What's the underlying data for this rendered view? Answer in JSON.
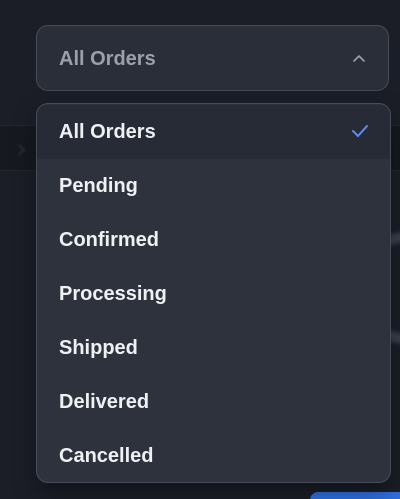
{
  "select": {
    "value": "All Orders",
    "expanded": true
  },
  "dropdown": {
    "selected_index": 0,
    "items": [
      {
        "label": "All Orders"
      },
      {
        "label": "Pending"
      },
      {
        "label": "Confirmed"
      },
      {
        "label": "Processing"
      },
      {
        "label": "Shipped"
      },
      {
        "label": "Delivered"
      },
      {
        "label": "Cancelled"
      }
    ]
  },
  "colors": {
    "accent": "#5b8def",
    "menu_background": "#2e323d",
    "page_background": "#1b1e27"
  },
  "icons": {
    "chevron": "chevron-up-icon",
    "check": "check-icon"
  }
}
